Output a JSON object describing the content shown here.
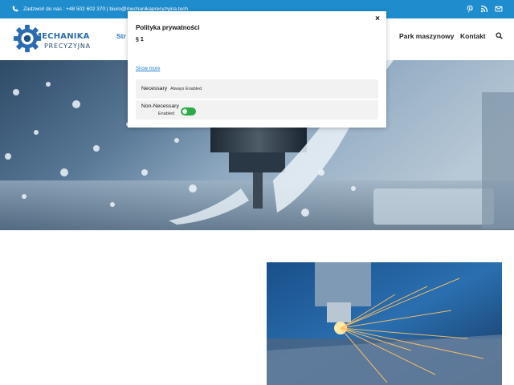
{
  "topbar": {
    "contact": "Zadzwoń do nas : +48 502 602 370  |  biuro@mechanikaprecyzyjna.tech",
    "icons": [
      "phone-icon",
      "pinterest-icon",
      "rss-icon",
      "mail-icon"
    ],
    "background": "#1f8ccd"
  },
  "logo": {
    "line1": "MECHANIKA",
    "line2": "PRECYZYJNA"
  },
  "nav": {
    "first": "Str",
    "park": "Park maszynowy",
    "kontakt": "Kontakt",
    "accent": "#2b7bbf"
  },
  "modal": {
    "close": "×",
    "title": "Polityka prywatności",
    "section": "§ 1",
    "show_more": "Show more",
    "necessary_label": "Necessary",
    "necessary_status": "Always Enabled",
    "non_necessary_label": "Non-Necessary",
    "non_necessary_status": "Enabled",
    "toggle_color": "#2eaa4a"
  }
}
